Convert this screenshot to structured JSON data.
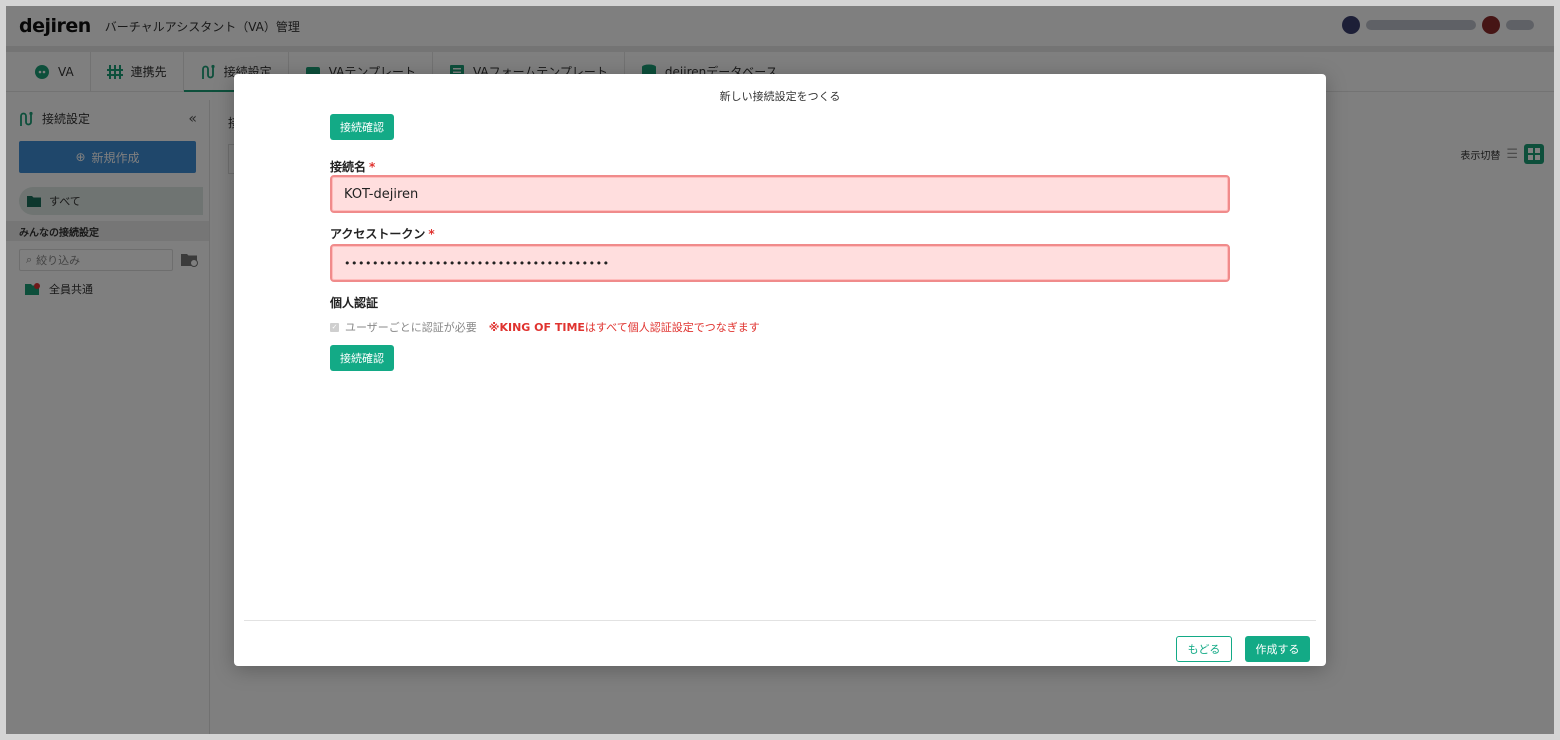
{
  "header": {
    "logo": "dejiren",
    "app_title": "バーチャルアシスタント（VA）管理"
  },
  "tabs": [
    {
      "label": "VA",
      "icon": "robot-icon"
    },
    {
      "label": "連携先",
      "icon": "sliders-icon"
    },
    {
      "label": "接続設定",
      "icon": "connection-icon",
      "active": true
    },
    {
      "label": "VAテンプレート",
      "icon": "template-icon"
    },
    {
      "label": "VAフォームテンプレート",
      "icon": "form-template-icon"
    },
    {
      "label": "dejirenデータベース",
      "icon": "database-icon"
    }
  ],
  "sidebar": {
    "title": "接続設定",
    "new_button": "新規作成",
    "all_label": "すべて",
    "section_label": "みんなの接続設定",
    "filter_placeholder": "絞り込み",
    "item_label": "全員共通"
  },
  "main": {
    "breadcrumb": "接",
    "view_toggle_label": "表示切替"
  },
  "modal": {
    "title": "新しい接続設定をつくる",
    "check_button_top": "接続確認",
    "name_label": "接続名",
    "name_value": "KOT-dejiren",
    "token_label": "アクセストークン",
    "token_value": "••••••••••••••••••••••••••••••••••••••",
    "personal_auth_label": "個人認証",
    "personal_auth_checkbox": "ユーザーごとに認証が必要",
    "note_part1": "※KING OF TIME",
    "note_part2": "はすべて個人認証設定でつなぎます",
    "check_button_bottom": "接続確認",
    "back_button": "もどる",
    "create_button": "作成する"
  },
  "colors": {
    "accent_green": "#13aa86",
    "sidebar_blue": "#3e8ed6",
    "error_red": "#e0332f",
    "invalid_bg": "#ffdede",
    "invalid_border": "#f08b8b"
  }
}
